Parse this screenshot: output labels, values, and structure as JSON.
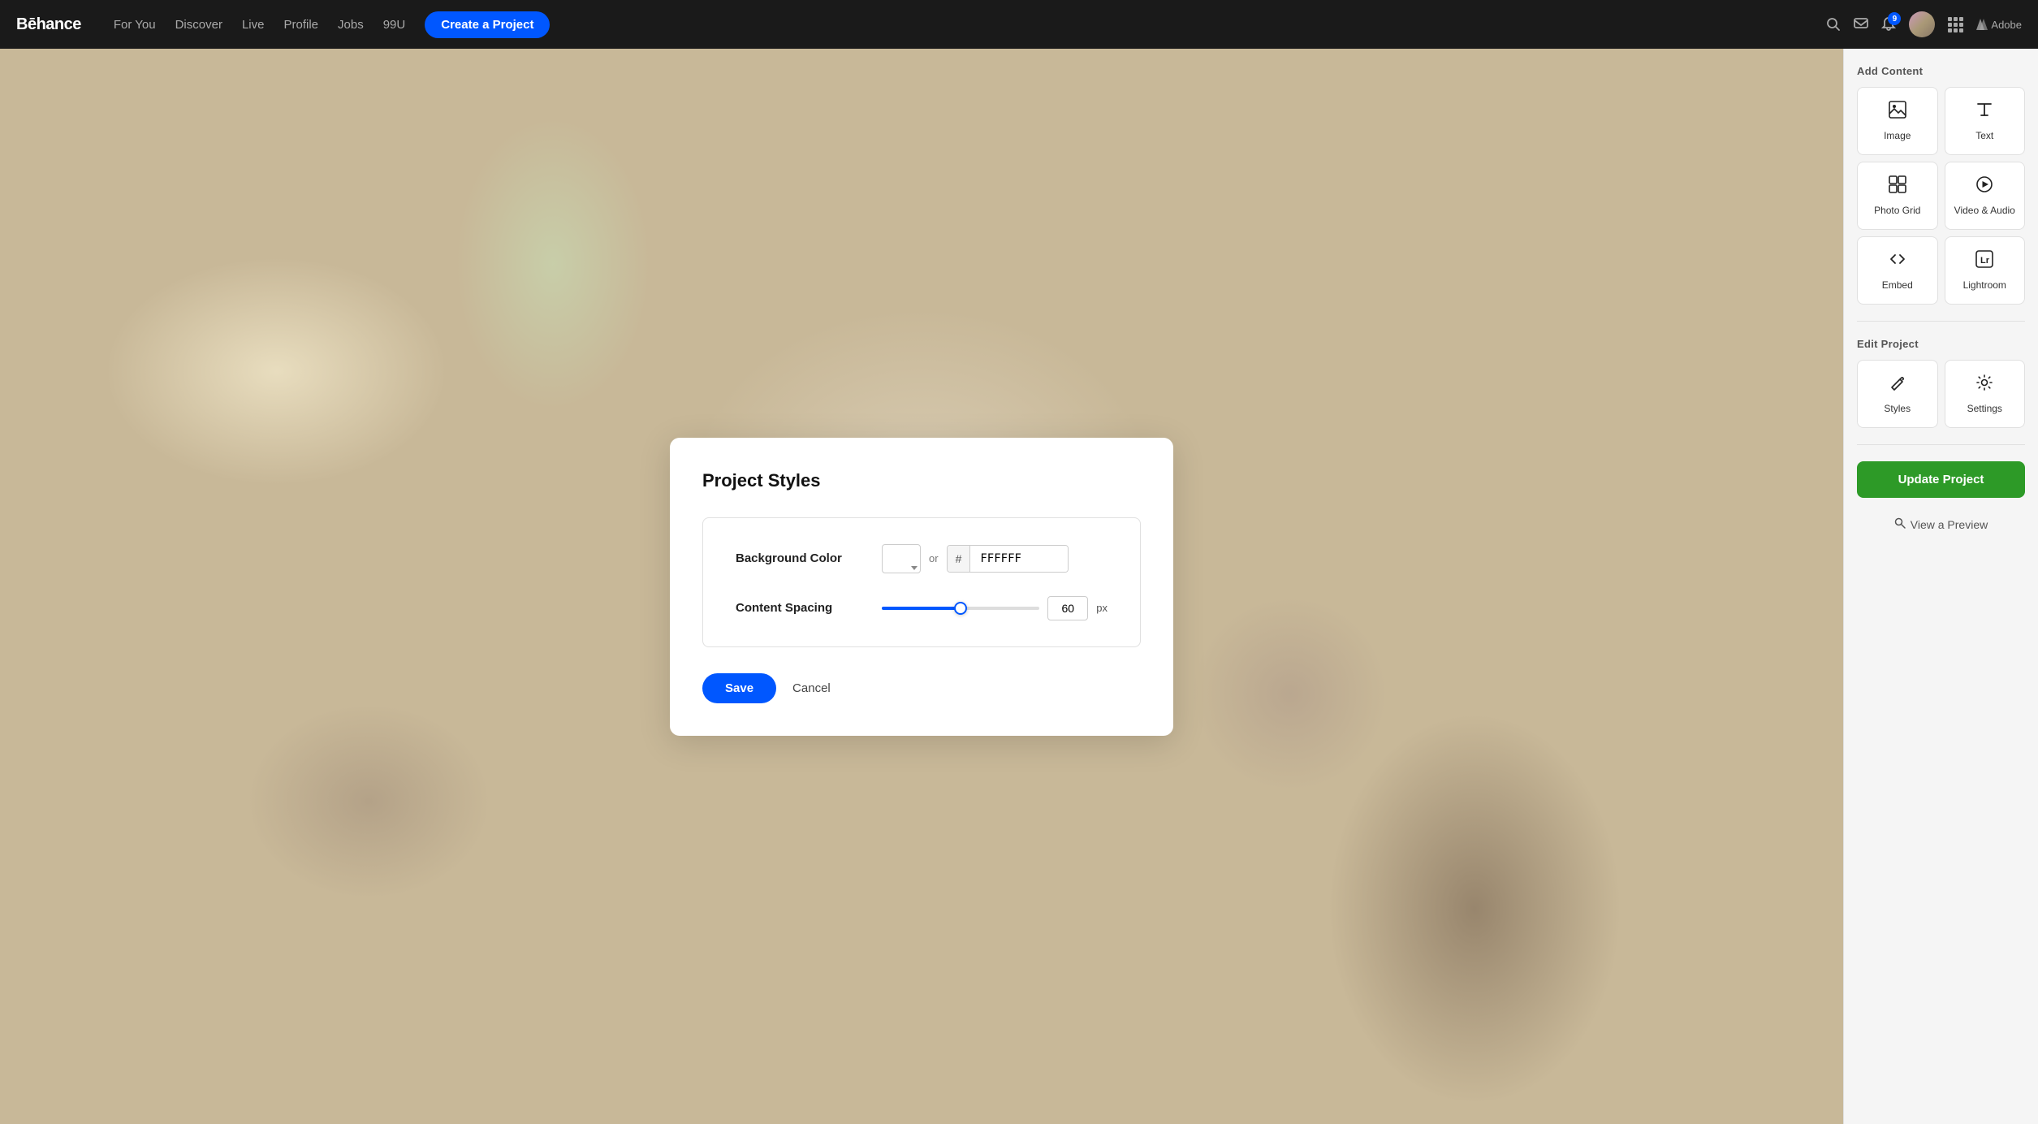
{
  "navbar": {
    "logo": "Bēhance",
    "nav_items": [
      {
        "label": "For You",
        "id": "for-you"
      },
      {
        "label": "Discover",
        "id": "discover"
      },
      {
        "label": "Live",
        "id": "live"
      },
      {
        "label": "Profile",
        "id": "profile"
      },
      {
        "label": "Jobs",
        "id": "jobs"
      },
      {
        "label": "99U",
        "id": "99u"
      }
    ],
    "create_btn": "Create a Project",
    "notification_count": "9",
    "adobe_label": "Adobe"
  },
  "modal": {
    "title": "Project Styles",
    "background_color_label": "Background Color",
    "color_value": "FFFFFF",
    "or_label": "or",
    "hash_symbol": "#",
    "hex_value": "FFFFFF",
    "content_spacing_label": "Content Spacing",
    "spacing_value": "60",
    "px_label": "px",
    "save_btn": "Save",
    "cancel_btn": "Cancel"
  },
  "sidebar": {
    "add_content_title": "Add Content",
    "content_items": [
      {
        "label": "Image",
        "id": "image",
        "icon": "image"
      },
      {
        "label": "Text",
        "id": "text",
        "icon": "text"
      },
      {
        "label": "Photo Grid",
        "id": "photo-grid",
        "icon": "grid"
      },
      {
        "label": "Video & Audio",
        "id": "video-audio",
        "icon": "play"
      },
      {
        "label": "Embed",
        "id": "embed",
        "icon": "embed"
      },
      {
        "label": "Lightroom",
        "id": "lightroom",
        "icon": "lightroom"
      }
    ],
    "edit_project_title": "Edit Project",
    "edit_items": [
      {
        "label": "Styles",
        "id": "styles",
        "icon": "pencil"
      },
      {
        "label": "Settings",
        "id": "settings",
        "icon": "gear"
      }
    ],
    "update_btn": "Update Project",
    "preview_btn": "View a Preview"
  }
}
